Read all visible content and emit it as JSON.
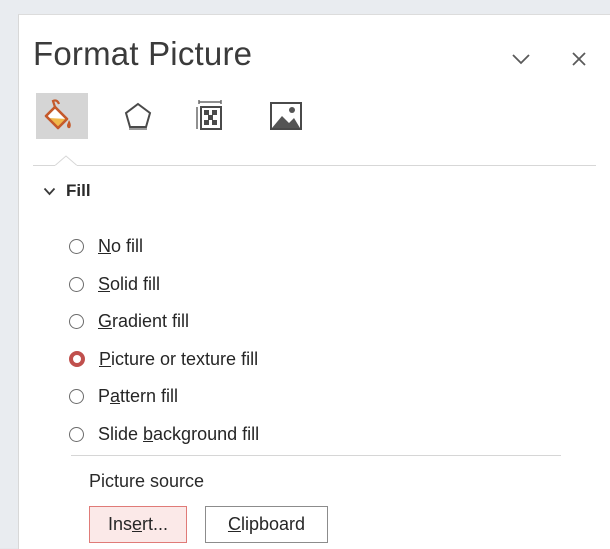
{
  "pane": {
    "title": "Format Picture",
    "collapse_icon": "chevron-down-icon",
    "close_icon": "close-icon"
  },
  "tabs": [
    {
      "name": "fill-line",
      "icon": "paint-bucket-icon",
      "active": true
    },
    {
      "name": "effects",
      "icon": "pentagon-icon",
      "active": false
    },
    {
      "name": "size-properties",
      "icon": "size-properties-icon",
      "active": false
    },
    {
      "name": "picture",
      "icon": "picture-icon",
      "active": false
    }
  ],
  "fill_section": {
    "label": "Fill",
    "expanded": true,
    "options": [
      {
        "pre": "",
        "key": "N",
        "post": "o fill",
        "checked": false
      },
      {
        "pre": "",
        "key": "S",
        "post": "olid fill",
        "checked": false
      },
      {
        "pre": "",
        "key": "G",
        "post": "radient fill",
        "checked": false
      },
      {
        "pre": "",
        "key": "P",
        "post": "icture or texture fill",
        "checked": true
      },
      {
        "pre": "P",
        "key": "a",
        "post": "ttern fill",
        "checked": false
      },
      {
        "pre": "Slide ",
        "key": "b",
        "post": "ackground fill",
        "checked": false
      }
    ]
  },
  "picture_source": {
    "label": "Picture source",
    "insert": {
      "pre": "Ins",
      "key": "e",
      "post": "rt..."
    },
    "clipboard": {
      "pre": "",
      "key": "C",
      "post": "lipboard"
    }
  },
  "colors": {
    "accent": "#c0504d",
    "insert_border": "#e07b78",
    "insert_bg": "#fbe9e8",
    "active_tab_bg": "#d5d5d5"
  }
}
